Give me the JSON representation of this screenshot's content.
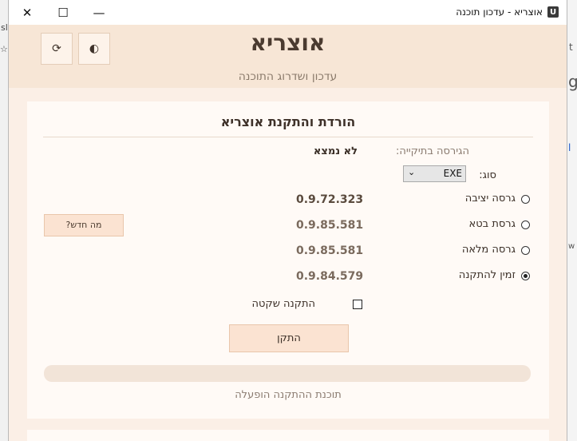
{
  "window": {
    "title": "אוצריא - עדכון תוכנה",
    "app_icon_glyph": "U",
    "controls": {
      "close": "✕",
      "maximize": "☐",
      "minimize": "—"
    }
  },
  "header": {
    "title": "אוצריא",
    "subtitle": "עדכון ושדרוג התוכנה",
    "refresh_icon": "⟳",
    "contrast_icon": "◐"
  },
  "card": {
    "title": "הורדת והתקנת אוצריא",
    "existing_version_label": "הגירסה בתיקייה:",
    "existing_version_value": "לא נמצא",
    "type_label": "סוג:",
    "type_value": "EXE",
    "options": [
      {
        "label": "גרסה יציבה",
        "version": "0.9.72.323",
        "checked": false
      },
      {
        "label": "גרסת בטא",
        "version": "0.9.85.581",
        "checked": false
      },
      {
        "label": "גרסה מלאה",
        "version": "0.9.85.581",
        "checked": false
      },
      {
        "label": "זמין להתקנה",
        "version": "0.9.84.579",
        "checked": true
      }
    ],
    "whats_new_label": "מה חדש?",
    "silent_install_label": "התקנה שקטה",
    "silent_install_checked": false,
    "install_button_label": "התקן",
    "progress": 0,
    "status_text": "תוכנת ההתקנה הופעלה"
  },
  "colors": {
    "header_bg": "#f7e6d6",
    "card_bg": "#fffaf6",
    "button_bg": "#fbe3d2",
    "text_dark": "#3b2f27"
  }
}
